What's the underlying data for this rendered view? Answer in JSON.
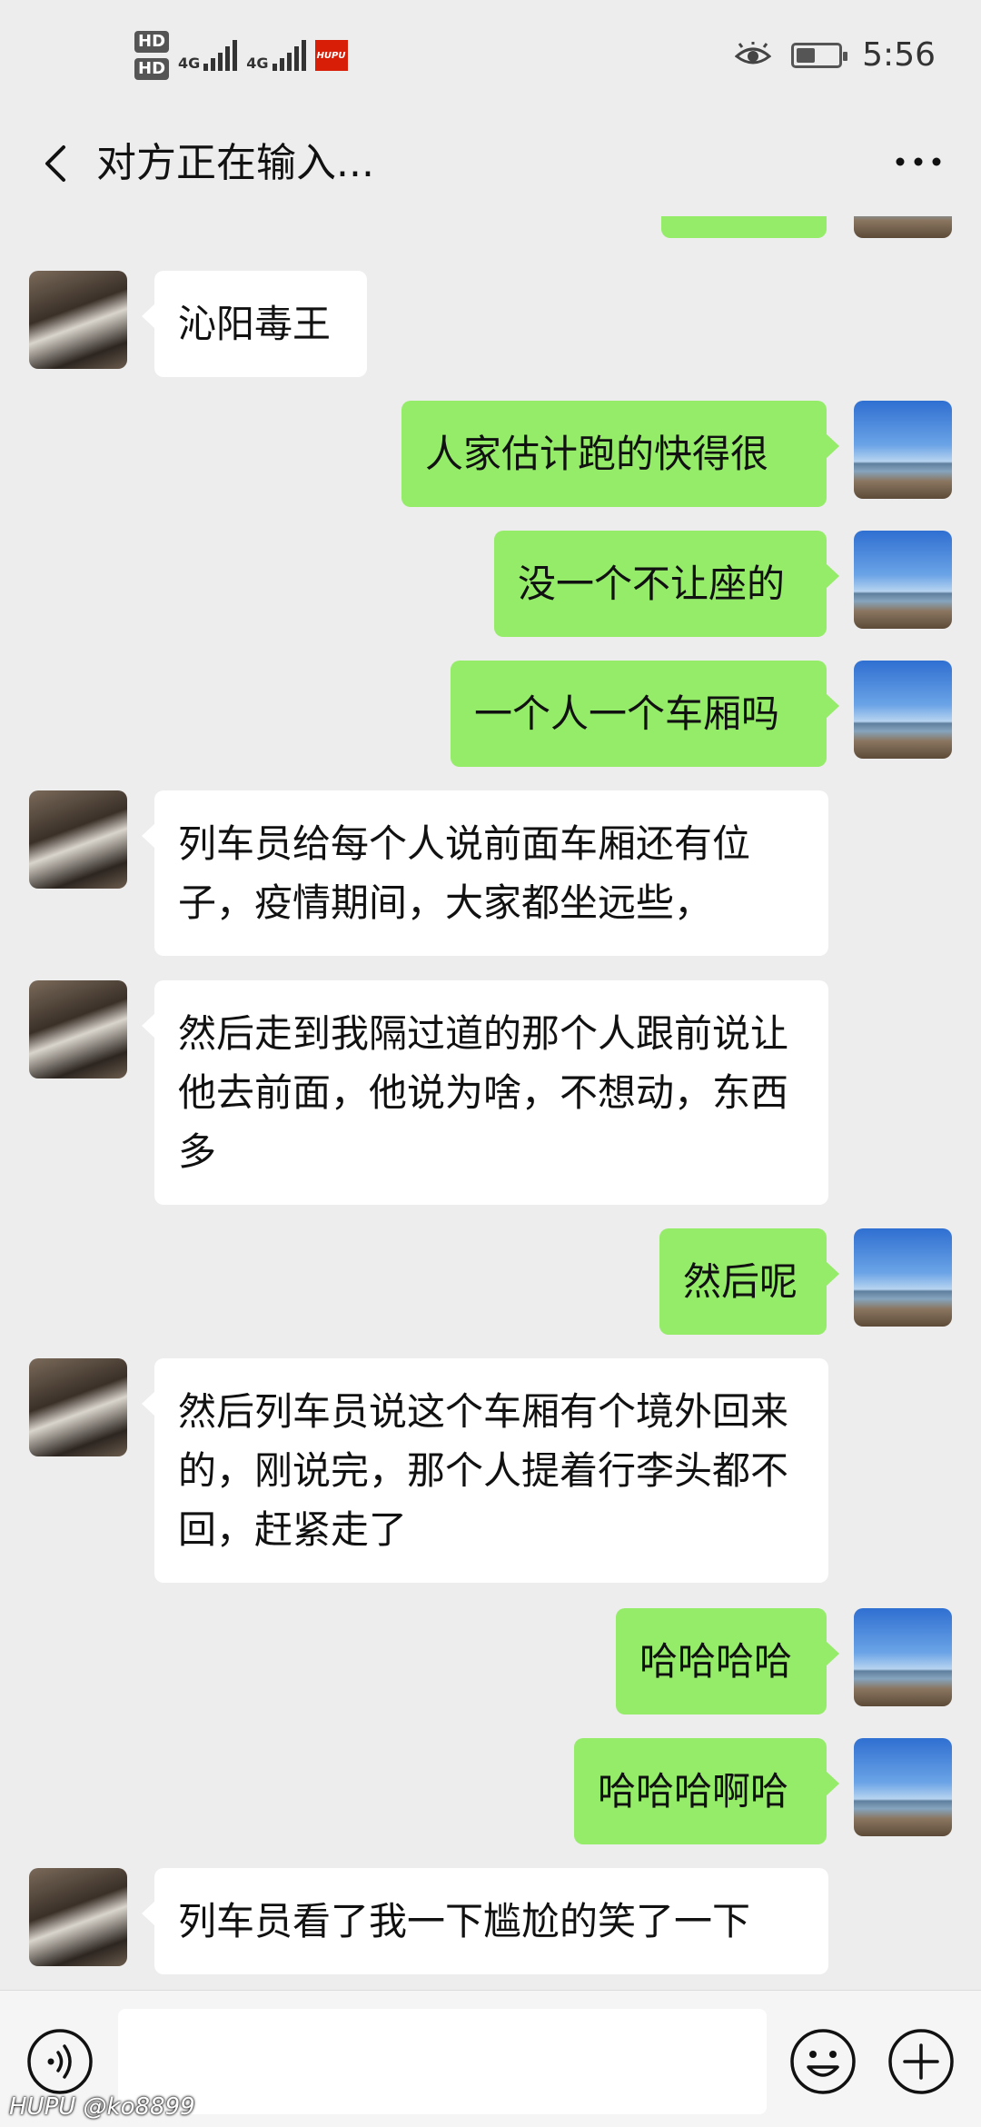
{
  "status_bar": {
    "sim1": "HD",
    "sim2": "HD",
    "net1": "4G",
    "net2": "4G",
    "app_badge": "HUPU",
    "time": "5:56"
  },
  "nav": {
    "title": "对方正在输入..."
  },
  "messages": [
    {
      "side": "in",
      "text": "沁阳毒王"
    },
    {
      "side": "out",
      "text": "人家估计跑的快得很"
    },
    {
      "side": "out",
      "text": "没一个不让座的"
    },
    {
      "side": "out",
      "text": "一个人一个车厢吗"
    },
    {
      "side": "in",
      "text": "列车员给每个人说前面车厢还有位子，疫情期间，大家都坐远些，"
    },
    {
      "side": "in",
      "text": "然后走到我隔过道的那个人跟前说让他去前面，他说为啥，不想动，东西多"
    },
    {
      "side": "out",
      "text": "然后呢"
    },
    {
      "side": "in",
      "text": "然后列车员说这个车厢有个境外回来的，刚说完，那个人提着行李头都不回，赶紧走了"
    },
    {
      "side": "out",
      "text": "哈哈哈哈"
    },
    {
      "side": "out",
      "text": "哈哈哈啊哈"
    },
    {
      "side": "in",
      "text": "列车员看了我一下尴尬的笑了一下"
    }
  ],
  "input": {
    "placeholder": ""
  },
  "watermark": "HUPU @ko8899",
  "colors": {
    "background": "#ededed",
    "bubble_out": "#95ec69",
    "bubble_in": "#ffffff"
  }
}
